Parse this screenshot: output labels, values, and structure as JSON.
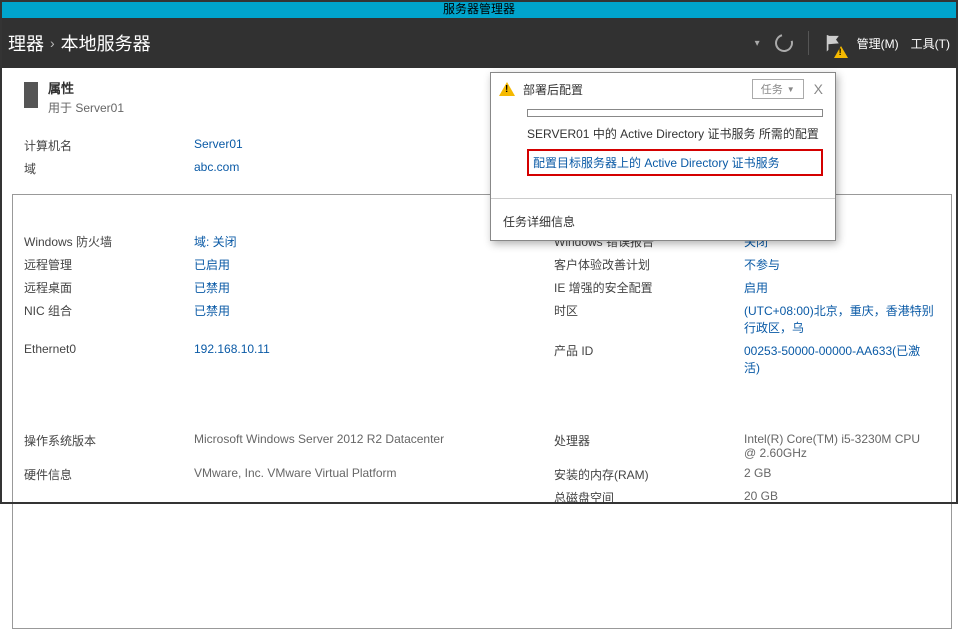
{
  "app_title": "服务器管理器",
  "header": {
    "crumb1": "理器",
    "crumb2": "本地服务器",
    "menu_manage": "管理(M)",
    "menu_tools": "工具(T)"
  },
  "properties": {
    "title": "属性",
    "subtitle": "用于 Server01"
  },
  "left_rows": [
    {
      "label": "计算机名",
      "value": "Server01",
      "link": true
    },
    {
      "label": "域",
      "value": "abc.com",
      "link": true
    }
  ],
  "left_rows2": [
    {
      "label": "Windows 防火墙",
      "value": "域: 关闭",
      "link": true
    },
    {
      "label": "远程管理",
      "value": "已启用",
      "link": true
    },
    {
      "label": "远程桌面",
      "value": "已禁用",
      "link": true
    },
    {
      "label": "NIC 组合",
      "value": "已禁用",
      "link": true
    },
    {
      "label": "Ethernet0",
      "value": "192.168.10.11",
      "link": true
    }
  ],
  "left_rows3": [
    {
      "label": "操作系统版本",
      "value": "Microsoft Windows Server 2012 R2 Datacenter",
      "link": false
    },
    {
      "label": "硬件信息",
      "value": "VMware, Inc. VMware Virtual Platform",
      "link": false
    }
  ],
  "right_rows2": [
    {
      "label": "Windows 错误报告",
      "value": "关闭",
      "link": true
    },
    {
      "label": "客户体验改善计划",
      "value": "不参与",
      "link": true
    },
    {
      "label": "IE 增强的安全配置",
      "value": "启用",
      "link": true
    },
    {
      "label": "时区",
      "value": "(UTC+08:00)北京，重庆，香港特别行政区，乌",
      "link": true
    },
    {
      "label": "产品 ID",
      "value": "00253-50000-00000-AA633(已激活)",
      "link": true
    }
  ],
  "right_rows3": [
    {
      "label": "处理器",
      "value": "Intel(R) Core(TM) i5-3230M CPU @ 2.60GHz"
    },
    {
      "label": "安装的内存(RAM)",
      "value": "2 GB"
    },
    {
      "label": "总磁盘空间",
      "value": "20 GB"
    }
  ],
  "popout": {
    "title": "部署后配置",
    "task_btn": "任务",
    "close": "X",
    "desc": "SERVER01 中的 Active Directory 证书服务 所需的配置",
    "action_link": "配置目标服务器上的 Active Directory 证书服务",
    "footer": "任务详细信息"
  }
}
